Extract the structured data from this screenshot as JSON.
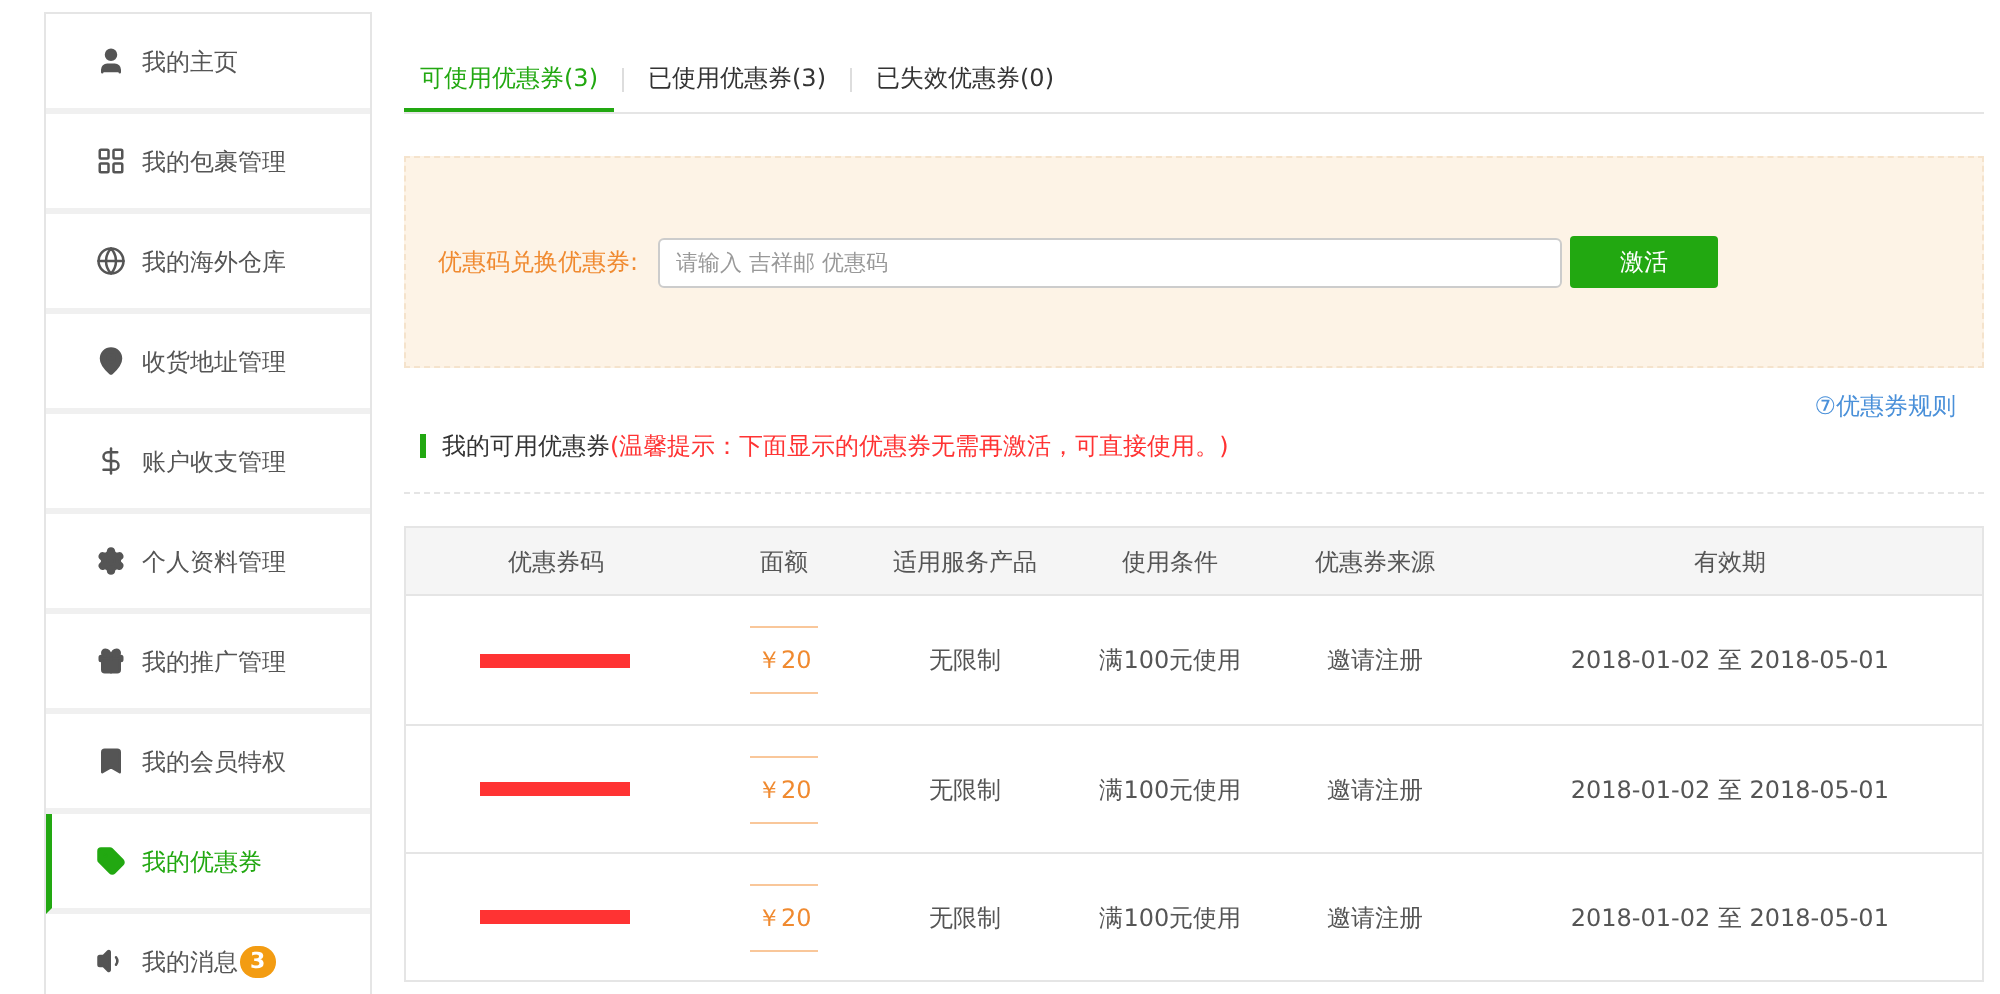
{
  "sidebar": {
    "items": [
      {
        "label": "我的主页",
        "selected": false
      },
      {
        "label": "我的包裹管理",
        "selected": false
      },
      {
        "label": "我的海外仓库",
        "selected": false
      },
      {
        "label": "收货地址管理",
        "selected": false
      },
      {
        "label": "账户收支管理",
        "selected": false
      },
      {
        "label": "个人资料管理",
        "selected": false
      },
      {
        "label": "我的推广管理",
        "selected": false
      },
      {
        "label": "我的会员特权",
        "selected": false
      },
      {
        "label": "我的优惠券",
        "selected": true
      },
      {
        "label": "我的消息",
        "selected": false,
        "badge": "3"
      }
    ]
  },
  "tabs": [
    {
      "label": "可使用优惠券(3)",
      "selected": true
    },
    {
      "label": "已使用优惠券(3)",
      "selected": false
    },
    {
      "label": "已失效优惠券(0)",
      "selected": false
    }
  ],
  "redeem": {
    "label": "优惠码兑换优惠券:",
    "placeholder": "请输入 吉祥邮 优惠码",
    "button": "激活"
  },
  "rules_link": "⑦优惠券规则",
  "section": {
    "title": "我的可用优惠券",
    "notice": "(温馨提示：下面显示的优惠券无需再激活，可直接使用。)"
  },
  "table": {
    "columns": [
      "优惠券码",
      "面额",
      "适用服务产品",
      "使用条件",
      "优惠券来源",
      "有效期"
    ],
    "rows": [
      {
        "code_redacted": true,
        "amount": "￥20",
        "product": "无限制",
        "condition": "满100元使用",
        "source": "邀请注册",
        "validity": "2018-01-02 至 2018-05-01"
      },
      {
        "code_redacted": true,
        "amount": "￥20",
        "product": "无限制",
        "condition": "满100元使用",
        "source": "邀请注册",
        "validity": "2018-01-02 至 2018-05-01"
      },
      {
        "code_redacted": true,
        "amount": "￥20",
        "product": "无限制",
        "condition": "满100元使用",
        "source": "邀请注册",
        "validity": "2018-01-02 至 2018-05-01"
      }
    ]
  }
}
